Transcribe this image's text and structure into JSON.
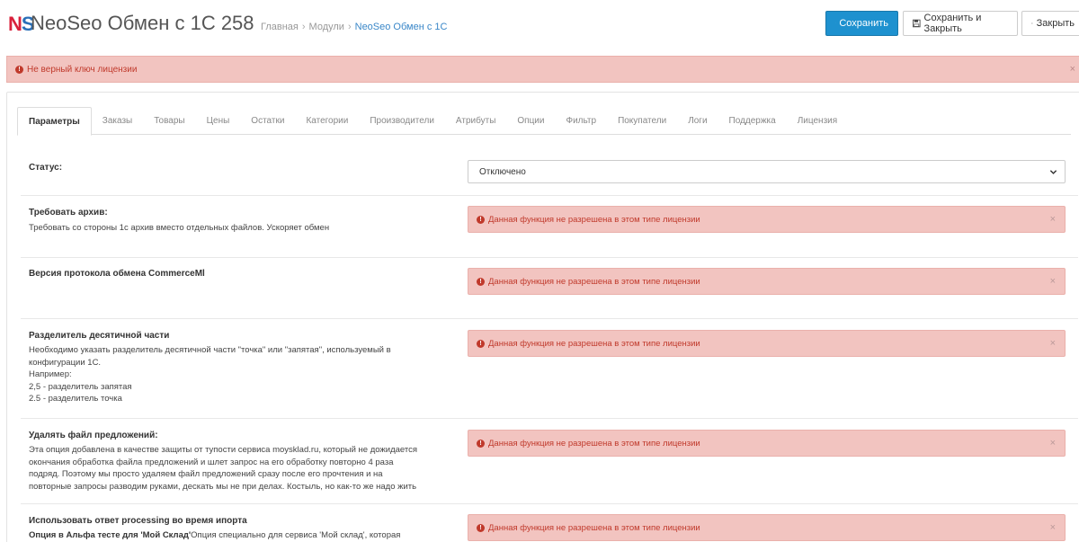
{
  "header": {
    "logo_text": "NS",
    "title": "NeoSeo Обмен с 1С 258",
    "breadcrumb": [
      "Главная",
      "Модули",
      "NeoSeo Обмен с 1С"
    ],
    "buttons": {
      "save": "Сохранить",
      "save_close": "Сохранить и Закрыть",
      "close": "Закрыть"
    }
  },
  "license_alert": {
    "text": "Не верный ключ лицензии",
    "close": "×"
  },
  "tabs": [
    "Параметры",
    "Заказы",
    "Товары",
    "Цены",
    "Остатки",
    "Категории",
    "Производители",
    "Атрибуты",
    "Опции",
    "Фильтр",
    "Покупатели",
    "Логи",
    "Поддержка",
    "Лицензия"
  ],
  "active_tab": "Параметры",
  "func_alert_text": "Данная функция не разрешена в этом типе лицензии",
  "settings": {
    "status": {
      "label": "Статус:",
      "value": "Отключено"
    },
    "archive": {
      "label": "Требовать архив:",
      "help": "Требовать со стороны 1с архив вместо отдельных файлов. Ускоряет обмен"
    },
    "protocol": {
      "label": "Версия протокола обмена CommerceMl"
    },
    "decimal": {
      "label": "Разделитель десятичной части",
      "help_lines": [
        "Необходимо указать разделитель десятичной части \"точка\" или \"запятая\", используемый в",
        "конфигурации 1С.",
        "Например:",
        "2,5 - разделитель запятая",
        "2.5 - разделитель точка"
      ]
    },
    "delete_offers": {
      "label": "Удалять файл предложений:",
      "help_lines": [
        "Эта опция добавлена в качестве защиты от тупости сервиса moysklad.ru, который не дожидается",
        "окончания обработка файла предложений и шлет запрос на его обработку повторно 4 раза",
        "подряд. Поэтому мы просто удаляем файл предложений сразу после его прочтения и на",
        "повторные запросы разводим руками, дескать мы не при делах. Костыль, но как-то же надо жить"
      ]
    },
    "processing": {
      "label": "Использовать ответ processing во время ипорта",
      "help_bold": "Опция в Альфа тесте для 'Мой Склад'",
      "help_rest": "Опция специально для сервиса 'Мой склад', которая"
    }
  },
  "colors": {
    "primary": "#1e91cf",
    "danger_bg": "#f2c4c0",
    "danger_text": "#c0392b",
    "logo_n": "#d9213b",
    "logo_s": "#2a6fb8"
  }
}
